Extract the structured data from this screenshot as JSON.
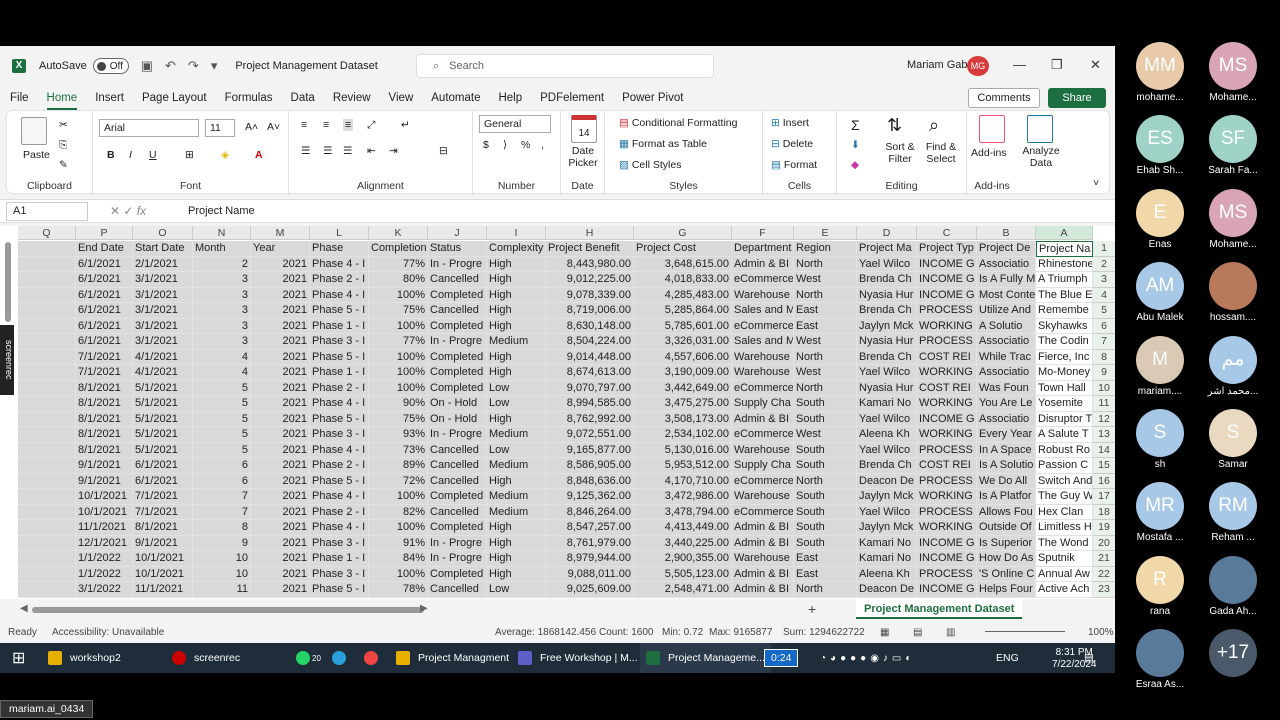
{
  "titlebar": {
    "autosave": "AutoSave",
    "toggle": "Off",
    "doc_title": "Project Management Dataset",
    "search": "Search",
    "user": "Mariam Gabr",
    "initials": "MG"
  },
  "tabs": [
    "File",
    "Home",
    "Insert",
    "Page Layout",
    "Formulas",
    "Data",
    "Review",
    "View",
    "Automate",
    "Help",
    "PDFelement",
    "Power Pivot"
  ],
  "comments": "Comments",
  "share": "Share",
  "ribbon": {
    "paste": "Paste",
    "clipboard": "Clipboard",
    "font_name": "Arial",
    "font_size": "11",
    "font": "Font",
    "alignment": "Alignment",
    "number_format": "General",
    "number": "Number",
    "date_picker": "Date Picker",
    "date": "Date",
    "date_day": "14",
    "cond_fmt": "Conditional Formatting",
    "fmt_table": "Format as Table",
    "cell_styles": "Cell Styles",
    "styles": "Styles",
    "insert": "Insert",
    "delete": "Delete",
    "format": "Format",
    "cells": "Cells",
    "sort_filter": "Sort & Filter",
    "find_select": "Find & Select",
    "editing": "Editing",
    "addins": "Add-ins",
    "analyze": "Analyze Data",
    "addins_grp": "Add-ins"
  },
  "formula_bar": {
    "name_box": "A1",
    "formula": "Project Name"
  },
  "columns": [
    "Q",
    "P",
    "O",
    "N",
    "M",
    "L",
    "K",
    "J",
    "I",
    "H",
    "G",
    "F",
    "E",
    "D",
    "C",
    "B",
    "A"
  ],
  "headers": [
    "",
    "End Date",
    "Start Date",
    "Month",
    "Year",
    "Phase",
    "Completion",
    "Status",
    "Complexity",
    "Project Benefit",
    "Project Cost",
    "Department",
    "Region",
    "Project Ma",
    "Project Typ",
    "Project De",
    "Project Na"
  ],
  "rows": [
    [
      "",
      "6/1/2021",
      "2/1/2021",
      "2",
      "2021",
      "Phase 4 - I",
      "77%",
      "In - Progre",
      "High",
      "8,443,980.00",
      "3,648,615.00",
      "Admin & BI",
      "North",
      "Yael Wilco",
      "INCOME G",
      "Associatio",
      "Rhinestone"
    ],
    [
      "",
      "6/1/2021",
      "3/1/2021",
      "3",
      "2021",
      "Phase 2 - I",
      "80%",
      "Cancelled",
      "High",
      "9,012,225.00",
      "4,018,833.00",
      "eCommerce",
      "West",
      "Brenda Ch",
      "INCOME G",
      "Is A Fully M",
      "A Triumph"
    ],
    [
      "",
      "6/1/2021",
      "3/1/2021",
      "3",
      "2021",
      "Phase 4 - I",
      "100%",
      "Completed",
      "High",
      "9,078,339.00",
      "4,285,483.00",
      "Warehouse",
      "North",
      "Nyasia Hur",
      "INCOME G",
      "Most Conte",
      "The Blue E"
    ],
    [
      "",
      "6/1/2021",
      "3/1/2021",
      "3",
      "2021",
      "Phase 5 - I",
      "75%",
      "Cancelled",
      "High",
      "8,719,006.00",
      "5,285,864.00",
      "Sales and M",
      "East",
      "Brenda Ch",
      "PROCESS",
      "Utilize And",
      "Remembe"
    ],
    [
      "",
      "6/1/2021",
      "3/1/2021",
      "3",
      "2021",
      "Phase 1 - I",
      "100%",
      "Completed",
      "High",
      "8,630,148.00",
      "5,785,601.00",
      "eCommerce",
      "East",
      "Jaylyn Mck",
      "WORKING",
      "A Solutio",
      "Skyhawks"
    ],
    [
      "",
      "6/1/2021",
      "3/1/2021",
      "3",
      "2021",
      "Phase 3 - I",
      "77%",
      "In - Progre",
      "Medium",
      "8,504,224.00",
      "3,326,031.00",
      "Sales and M",
      "West",
      "Nyasia Hur",
      "PROCESS",
      "Associatio",
      "The Codin"
    ],
    [
      "",
      "7/1/2021",
      "4/1/2021",
      "4",
      "2021",
      "Phase 5 - I",
      "100%",
      "Completed",
      "High",
      "9,014,448.00",
      "4,557,606.00",
      "Warehouse",
      "North",
      "Brenda Ch",
      "COST REI",
      "While Trac",
      "Fierce, Inc"
    ],
    [
      "",
      "7/1/2021",
      "4/1/2021",
      "4",
      "2021",
      "Phase 1 - I",
      "100%",
      "Completed",
      "High",
      "8,674,613.00",
      "3,190,009.00",
      "Warehouse",
      "West",
      "Yael Wilco",
      "WORKING",
      "Associatio",
      "Mo-Money"
    ],
    [
      "",
      "8/1/2021",
      "5/1/2021",
      "5",
      "2021",
      "Phase 2 - I",
      "100%",
      "Completed",
      "Low",
      "9,070,797.00",
      "3,442,649.00",
      "eCommerce",
      "North",
      "Nyasia Hur",
      "COST REI",
      "Was Foun",
      "Town Hall"
    ],
    [
      "",
      "8/1/2021",
      "5/1/2021",
      "5",
      "2021",
      "Phase 4 - I",
      "90%",
      "On - Hold",
      "Low",
      "8,994,585.00",
      "3,475,275.00",
      "Supply Cha",
      "South",
      "Kamari No",
      "WORKING",
      "You Are Le",
      "Yosemite"
    ],
    [
      "",
      "8/1/2021",
      "5/1/2021",
      "5",
      "2021",
      "Phase 5 - I",
      "75%",
      "On - Hold",
      "High",
      "8,762,992.00",
      "3,508,173.00",
      "Admin & BI",
      "South",
      "Yael Wilco",
      "INCOME G",
      "Associatio",
      "Disruptor T"
    ],
    [
      "",
      "8/1/2021",
      "5/1/2021",
      "5",
      "2021",
      "Phase 3 - I",
      "93%",
      "In - Progre",
      "Medium",
      "9,072,551.00",
      "2,534,102.00",
      "eCommerce",
      "West",
      "Aleena Kh",
      "WORKING",
      "Every Year",
      "A Salute T"
    ],
    [
      "",
      "8/1/2021",
      "5/1/2021",
      "5",
      "2021",
      "Phase 4 - I",
      "73%",
      "Cancelled",
      "Low",
      "9,165,877.00",
      "5,130,016.00",
      "Warehouse",
      "South",
      "Yael Wilco",
      "PROCESS",
      "In A Space",
      "Robust Ro"
    ],
    [
      "",
      "9/1/2021",
      "6/1/2021",
      "6",
      "2021",
      "Phase 2 - I",
      "89%",
      "Cancelled",
      "Medium",
      "8,586,905.00",
      "5,953,512.00",
      "Supply Cha",
      "South",
      "Brenda Ch",
      "COST REI",
      "Is A Solutio",
      "Passion C"
    ],
    [
      "",
      "9/1/2021",
      "6/1/2021",
      "6",
      "2021",
      "Phase 5 - I",
      "72%",
      "Cancelled",
      "High",
      "8,848,636.00",
      "4,170,710.00",
      "eCommerce",
      "North",
      "Deacon De",
      "PROCESS",
      "We Do All",
      "Switch And"
    ],
    [
      "",
      "10/1/2021",
      "7/1/2021",
      "7",
      "2021",
      "Phase 4 - I",
      "100%",
      "Completed",
      "Medium",
      "9,125,362.00",
      "3,472,986.00",
      "Warehouse",
      "South",
      "Jaylyn Mck",
      "WORKING",
      "Is A Platfor",
      "The Guy W"
    ],
    [
      "",
      "10/1/2021",
      "7/1/2021",
      "7",
      "2021",
      "Phase 2 - I",
      "82%",
      "Cancelled",
      "Medium",
      "8,846,264.00",
      "3,478,794.00",
      "eCommerce",
      "South",
      "Yael Wilco",
      "PROCESS",
      "Allows Fou",
      "Hex Clan"
    ],
    [
      "",
      "11/1/2021",
      "8/1/2021",
      "8",
      "2021",
      "Phase 4 - I",
      "100%",
      "Completed",
      "High",
      "8,547,257.00",
      "4,413,449.00",
      "Admin & BI",
      "South",
      "Jaylyn Mck",
      "WORKING",
      "Outside Of",
      "Limitless H"
    ],
    [
      "",
      "12/1/2021",
      "9/1/2021",
      "9",
      "2021",
      "Phase 3 - I",
      "91%",
      "In - Progre",
      "High",
      "8,761,979.00",
      "3,440,225.00",
      "Admin & BI",
      "South",
      "Kamari No",
      "INCOME G",
      "Is Superior",
      "The Wond"
    ],
    [
      "",
      "1/1/2022",
      "10/1/2021",
      "10",
      "2021",
      "Phase 1 - I",
      "84%",
      "In - Progre",
      "High",
      "8,979,944.00",
      "2,900,355.00",
      "Warehouse",
      "East",
      "Kamari No",
      "INCOME G",
      "How Do As",
      "Sputnik"
    ],
    [
      "",
      "1/1/2022",
      "10/1/2021",
      "10",
      "2021",
      "Phase 3 - I",
      "100%",
      "Completed",
      "High",
      "9,088,011.00",
      "5,505,123.00",
      "Admin & BI",
      "East",
      "Aleena Kh",
      "PROCESS",
      "'S Online C",
      "Annual Aw"
    ],
    [
      "",
      "3/1/2022",
      "11/1/2021",
      "11",
      "2021",
      "Phase 5 - I",
      "78%",
      "Cancelled",
      "Low",
      "9,025,609.00",
      "2,548,471.00",
      "Admin & BI",
      "North",
      "Deacon De",
      "INCOME G",
      "Helps Four",
      "Active Ach"
    ]
  ],
  "row_numbers": [
    "1",
    "2",
    "3",
    "4",
    "5",
    "6",
    "7",
    "8",
    "9",
    "10",
    "11",
    "12",
    "13",
    "14",
    "15",
    "16",
    "17",
    "18",
    "19",
    "20",
    "21",
    "22",
    "23"
  ],
  "sheet_tab": "Project Management Dataset",
  "status": {
    "ready": "Ready",
    "accessibility": "Accessibility: Unavailable",
    "average": "Average: 1868142.456",
    "count": "Count: 1600",
    "min": "Min: 0.72",
    "max": "Max: 9165877",
    "sum": "Sum: 1294622722",
    "zoom": "100%"
  },
  "taskbar": {
    "item1": "workshop2",
    "item2": "screenrec",
    "badge": "20",
    "item3": "Project Managment",
    "item4": "Free Workshop | M...",
    "item5": "Project Manageme...",
    "timer": "0:24",
    "lang": "ENG",
    "time": "8:31 PM",
    "date": "7/22/2024"
  },
  "participants": [
    {
      "initials": "MM",
      "name": "mohame...",
      "color": "#e8c9a8"
    },
    {
      "initials": "MS",
      "name": "Mohame...",
      "color": "#d9a5b5"
    },
    {
      "initials": "ES",
      "name": "Ehab Sh...",
      "color": "#9fd3c7"
    },
    {
      "initials": "SF",
      "name": "Sarah Fa...",
      "color": "#9fd3c7"
    },
    {
      "initials": "E",
      "name": "Enas",
      "color": "#f0d8a8"
    },
    {
      "initials": "MS",
      "name": "Mohame...",
      "color": "#d9a5b5"
    },
    {
      "initials": "AM",
      "name": "Abu Malek",
      "color": "#a8c8e8"
    },
    {
      "initials": "",
      "name": "hossam....",
      "color": "#b87a5a"
    },
    {
      "initials": "M",
      "name": "mariam....",
      "color": "#d9c9b5"
    },
    {
      "initials": "مم",
      "name": "محمد اشر...",
      "color": "#a8c8e8"
    },
    {
      "initials": "S",
      "name": "sh",
      "color": "#a8c8e8"
    },
    {
      "initials": "S",
      "name": "Samar",
      "color": "#e8d9c0"
    },
    {
      "initials": "MR",
      "name": "Mostafa ...",
      "color": "#a8c8e8"
    },
    {
      "initials": "RM",
      "name": "Reham ...",
      "color": "#a8c8e8"
    },
    {
      "initials": "R",
      "name": "rana",
      "color": "#f0d8a8"
    },
    {
      "initials": "",
      "name": "Gada Ah...",
      "color": "#5a7a9a"
    },
    {
      "initials": "",
      "name": "Esraa As...",
      "color": "#5a7a9a"
    },
    {
      "initials": "+17",
      "name": "",
      "color": "#4a5a6a"
    }
  ],
  "watermark": "mariam.ai_0434",
  "screenrec_side": "screenrec"
}
